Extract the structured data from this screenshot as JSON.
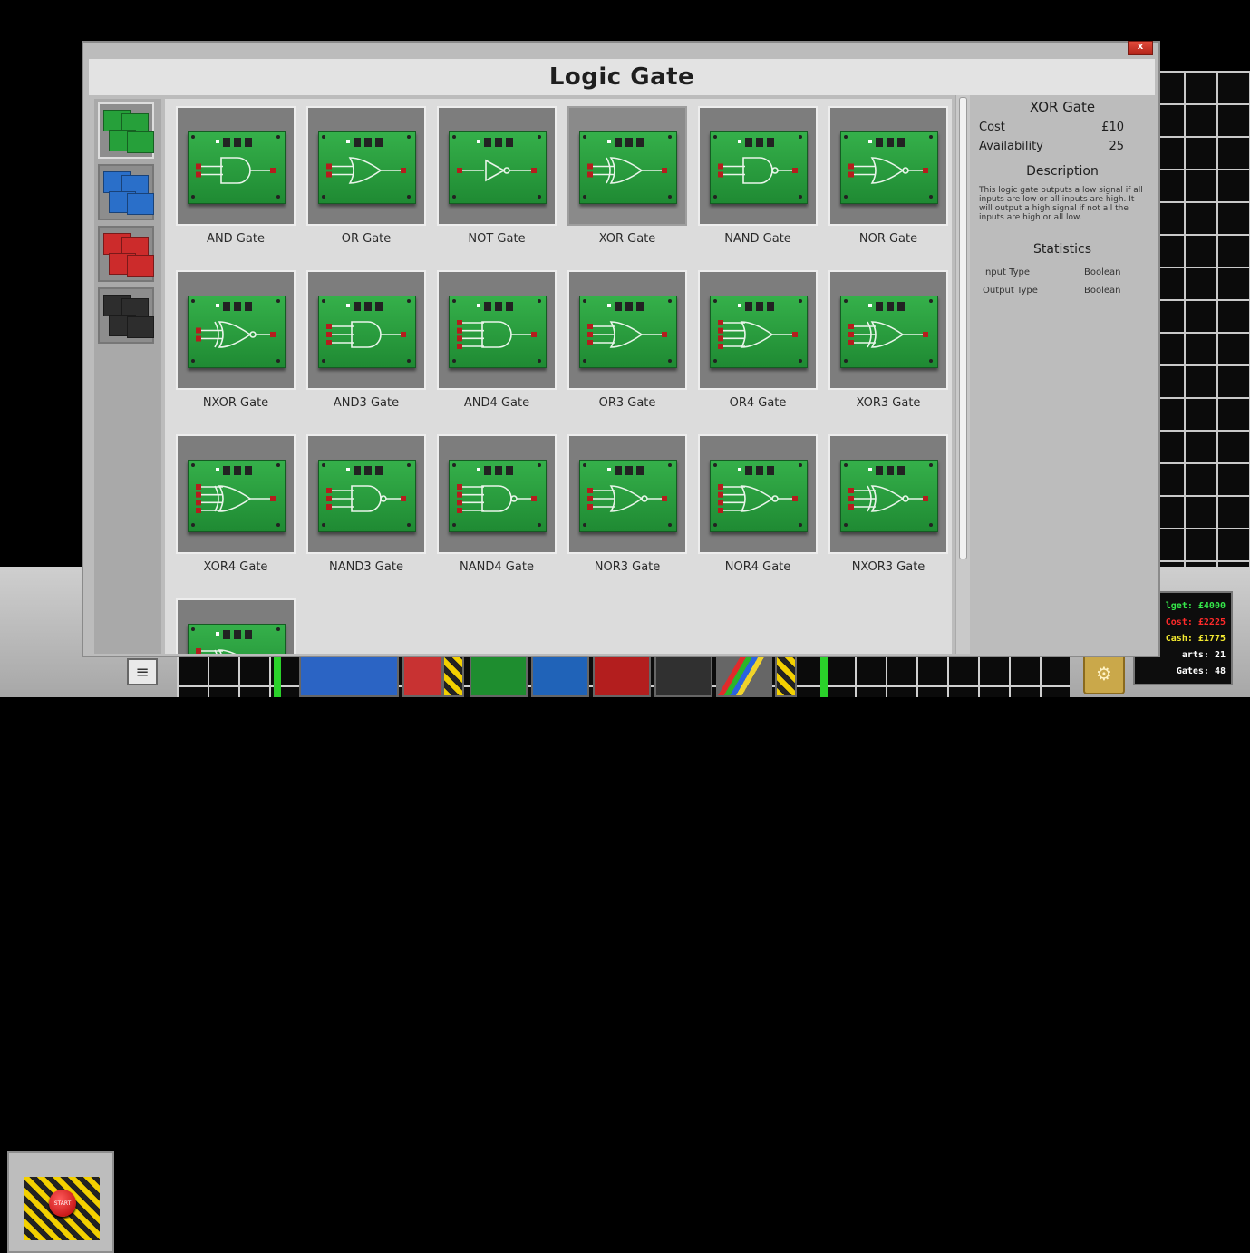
{
  "dialog": {
    "title": "Logic Gate",
    "close_label": "x"
  },
  "gates": [
    {
      "label": "AND Gate",
      "shape": "and",
      "inputs": 2
    },
    {
      "label": "OR Gate",
      "shape": "or",
      "inputs": 2
    },
    {
      "label": "NOT Gate",
      "shape": "not",
      "inputs": 1
    },
    {
      "label": "XOR Gate",
      "shape": "xor",
      "inputs": 2
    },
    {
      "label": "NAND Gate",
      "shape": "nand",
      "inputs": 2
    },
    {
      "label": "NOR Gate",
      "shape": "nor",
      "inputs": 2
    },
    {
      "label": "NXOR Gate",
      "shape": "nxor",
      "inputs": 2
    },
    {
      "label": "AND3 Gate",
      "shape": "and",
      "inputs": 3
    },
    {
      "label": "AND4 Gate",
      "shape": "and",
      "inputs": 4
    },
    {
      "label": "OR3 Gate",
      "shape": "or",
      "inputs": 3
    },
    {
      "label": "OR4 Gate",
      "shape": "or",
      "inputs": 4
    },
    {
      "label": "XOR3 Gate",
      "shape": "xor",
      "inputs": 3
    },
    {
      "label": "XOR4 Gate",
      "shape": "xor",
      "inputs": 4
    },
    {
      "label": "NAND3 Gate",
      "shape": "nand",
      "inputs": 3
    },
    {
      "label": "NAND4 Gate",
      "shape": "nand",
      "inputs": 4
    },
    {
      "label": "NOR3 Gate",
      "shape": "nor",
      "inputs": 3
    },
    {
      "label": "NOR4 Gate",
      "shape": "nor",
      "inputs": 4
    },
    {
      "label": "NXOR3 Gate",
      "shape": "nxor",
      "inputs": 3
    },
    {
      "label": "",
      "shape": "nxor",
      "inputs": 4
    }
  ],
  "selected_index": 3,
  "details": {
    "title": "XOR Gate",
    "cost_label": "Cost",
    "cost_value": "£10",
    "availability_label": "Availability",
    "availability_value": "25",
    "description_heading": "Description",
    "description": "This logic gate outputs a low signal if all inputs are low or all inputs are high. It will output a high signal if not all the inputs are high or all low.",
    "statistics_heading": "Statistics",
    "stats": [
      {
        "label": "Input Type",
        "value": "Boolean"
      },
      {
        "label": "Output Type",
        "value": "Boolean"
      }
    ]
  },
  "hud": {
    "start_label": "START",
    "budget": "lget: £4000",
    "cost": "Cost: £2225",
    "cash": "Cash: £1775",
    "parts": "arts: 21",
    "gates": "Gates: 48"
  },
  "colors": {
    "budget": "#35e84a",
    "cost": "#ff2a2a",
    "cash": "#f2e830",
    "parts": "#ffffff",
    "gates": "#ffffff",
    "cat_green": "#26a03a",
    "cat_blue": "#2a6fc9",
    "cat_red": "#cc2b2b",
    "cat_black": "#2d2d2d"
  },
  "icons": {
    "menu": "hamburger-icon",
    "close": "close-icon",
    "budget": "coins-icon"
  }
}
